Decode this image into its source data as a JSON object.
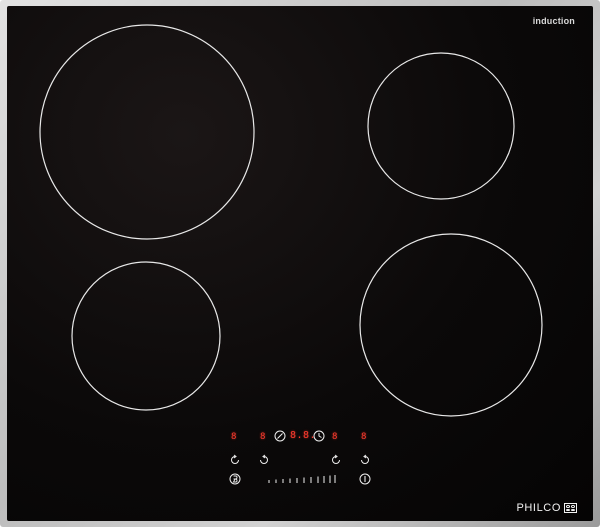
{
  "hob": {
    "label": "induction",
    "brand": "PHILCO",
    "frame_color": "#c9c9c9",
    "glass_color": "#0b0909",
    "zone_ring_color": "#e8e8e8",
    "display_color": "#ff3b2f"
  },
  "zones": [
    {
      "name": "zone-rear-left"
    },
    {
      "name": "zone-rear-right"
    },
    {
      "name": "zone-front-left"
    },
    {
      "name": "zone-front-right"
    }
  ],
  "controls": {
    "display_left_outer": "8",
    "display_left_inner": "8",
    "timer_display": "8.8.",
    "display_right_inner": "8",
    "display_right_outer": "8",
    "icons": {
      "lock": "lock-icon",
      "timer": "clock-icon",
      "power": "power-icon",
      "boost": "boost-icon",
      "zone_select": "circular-arrow-icon",
      "slider": "power-slider-icon"
    }
  }
}
